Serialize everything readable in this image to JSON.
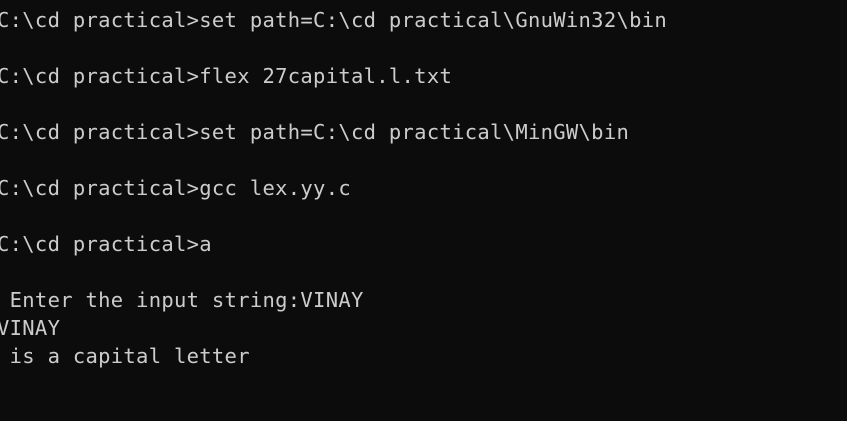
{
  "terminal": {
    "lines": [
      "C:\\cd practical>set path=C:\\cd practical\\GnuWin32\\bin",
      "C:\\cd practical>flex 27capital.l.txt",
      "C:\\cd practical>set path=C:\\cd practical\\MinGW\\bin",
      "C:\\cd practical>gcc lex.yy.c",
      "C:\\cd practical>a",
      " Enter the input string:VINAY",
      "VINAY",
      " is a capital letter"
    ]
  }
}
